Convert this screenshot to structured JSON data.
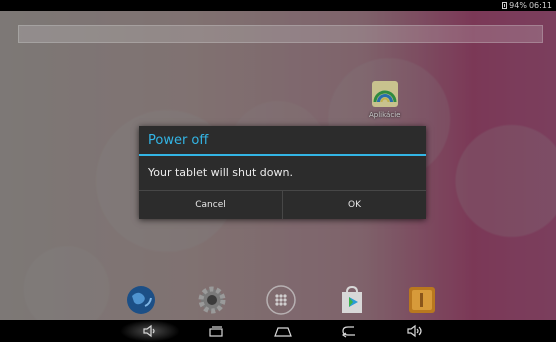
{
  "status_bar": {
    "battery_text": "94%",
    "time": "06:11",
    "icons": [
      "battery-icon"
    ]
  },
  "home": {
    "apps": [
      {
        "label": "Aplikácie",
        "icon": "rainbow-app-icon"
      }
    ],
    "dock": [
      {
        "icon": "browser-globe-icon"
      },
      {
        "icon": "settings-gear-icon"
      },
      {
        "icon": "app-drawer-icon"
      },
      {
        "icon": "play-store-icon"
      },
      {
        "icon": "file-manager-icon"
      }
    ]
  },
  "dialog": {
    "title": "Power off",
    "message": "Your tablet will shut down.",
    "cancel_label": "Cancel",
    "ok_label": "OK"
  },
  "nav_bar": {
    "icons": [
      "volume-down-icon",
      "recent-apps-icon",
      "home-icon",
      "back-icon",
      "volume-up-icon"
    ]
  },
  "colors": {
    "accent": "#33b5e5",
    "dialog_bg": "#2c2c2c",
    "bar_bg": "#000000"
  }
}
